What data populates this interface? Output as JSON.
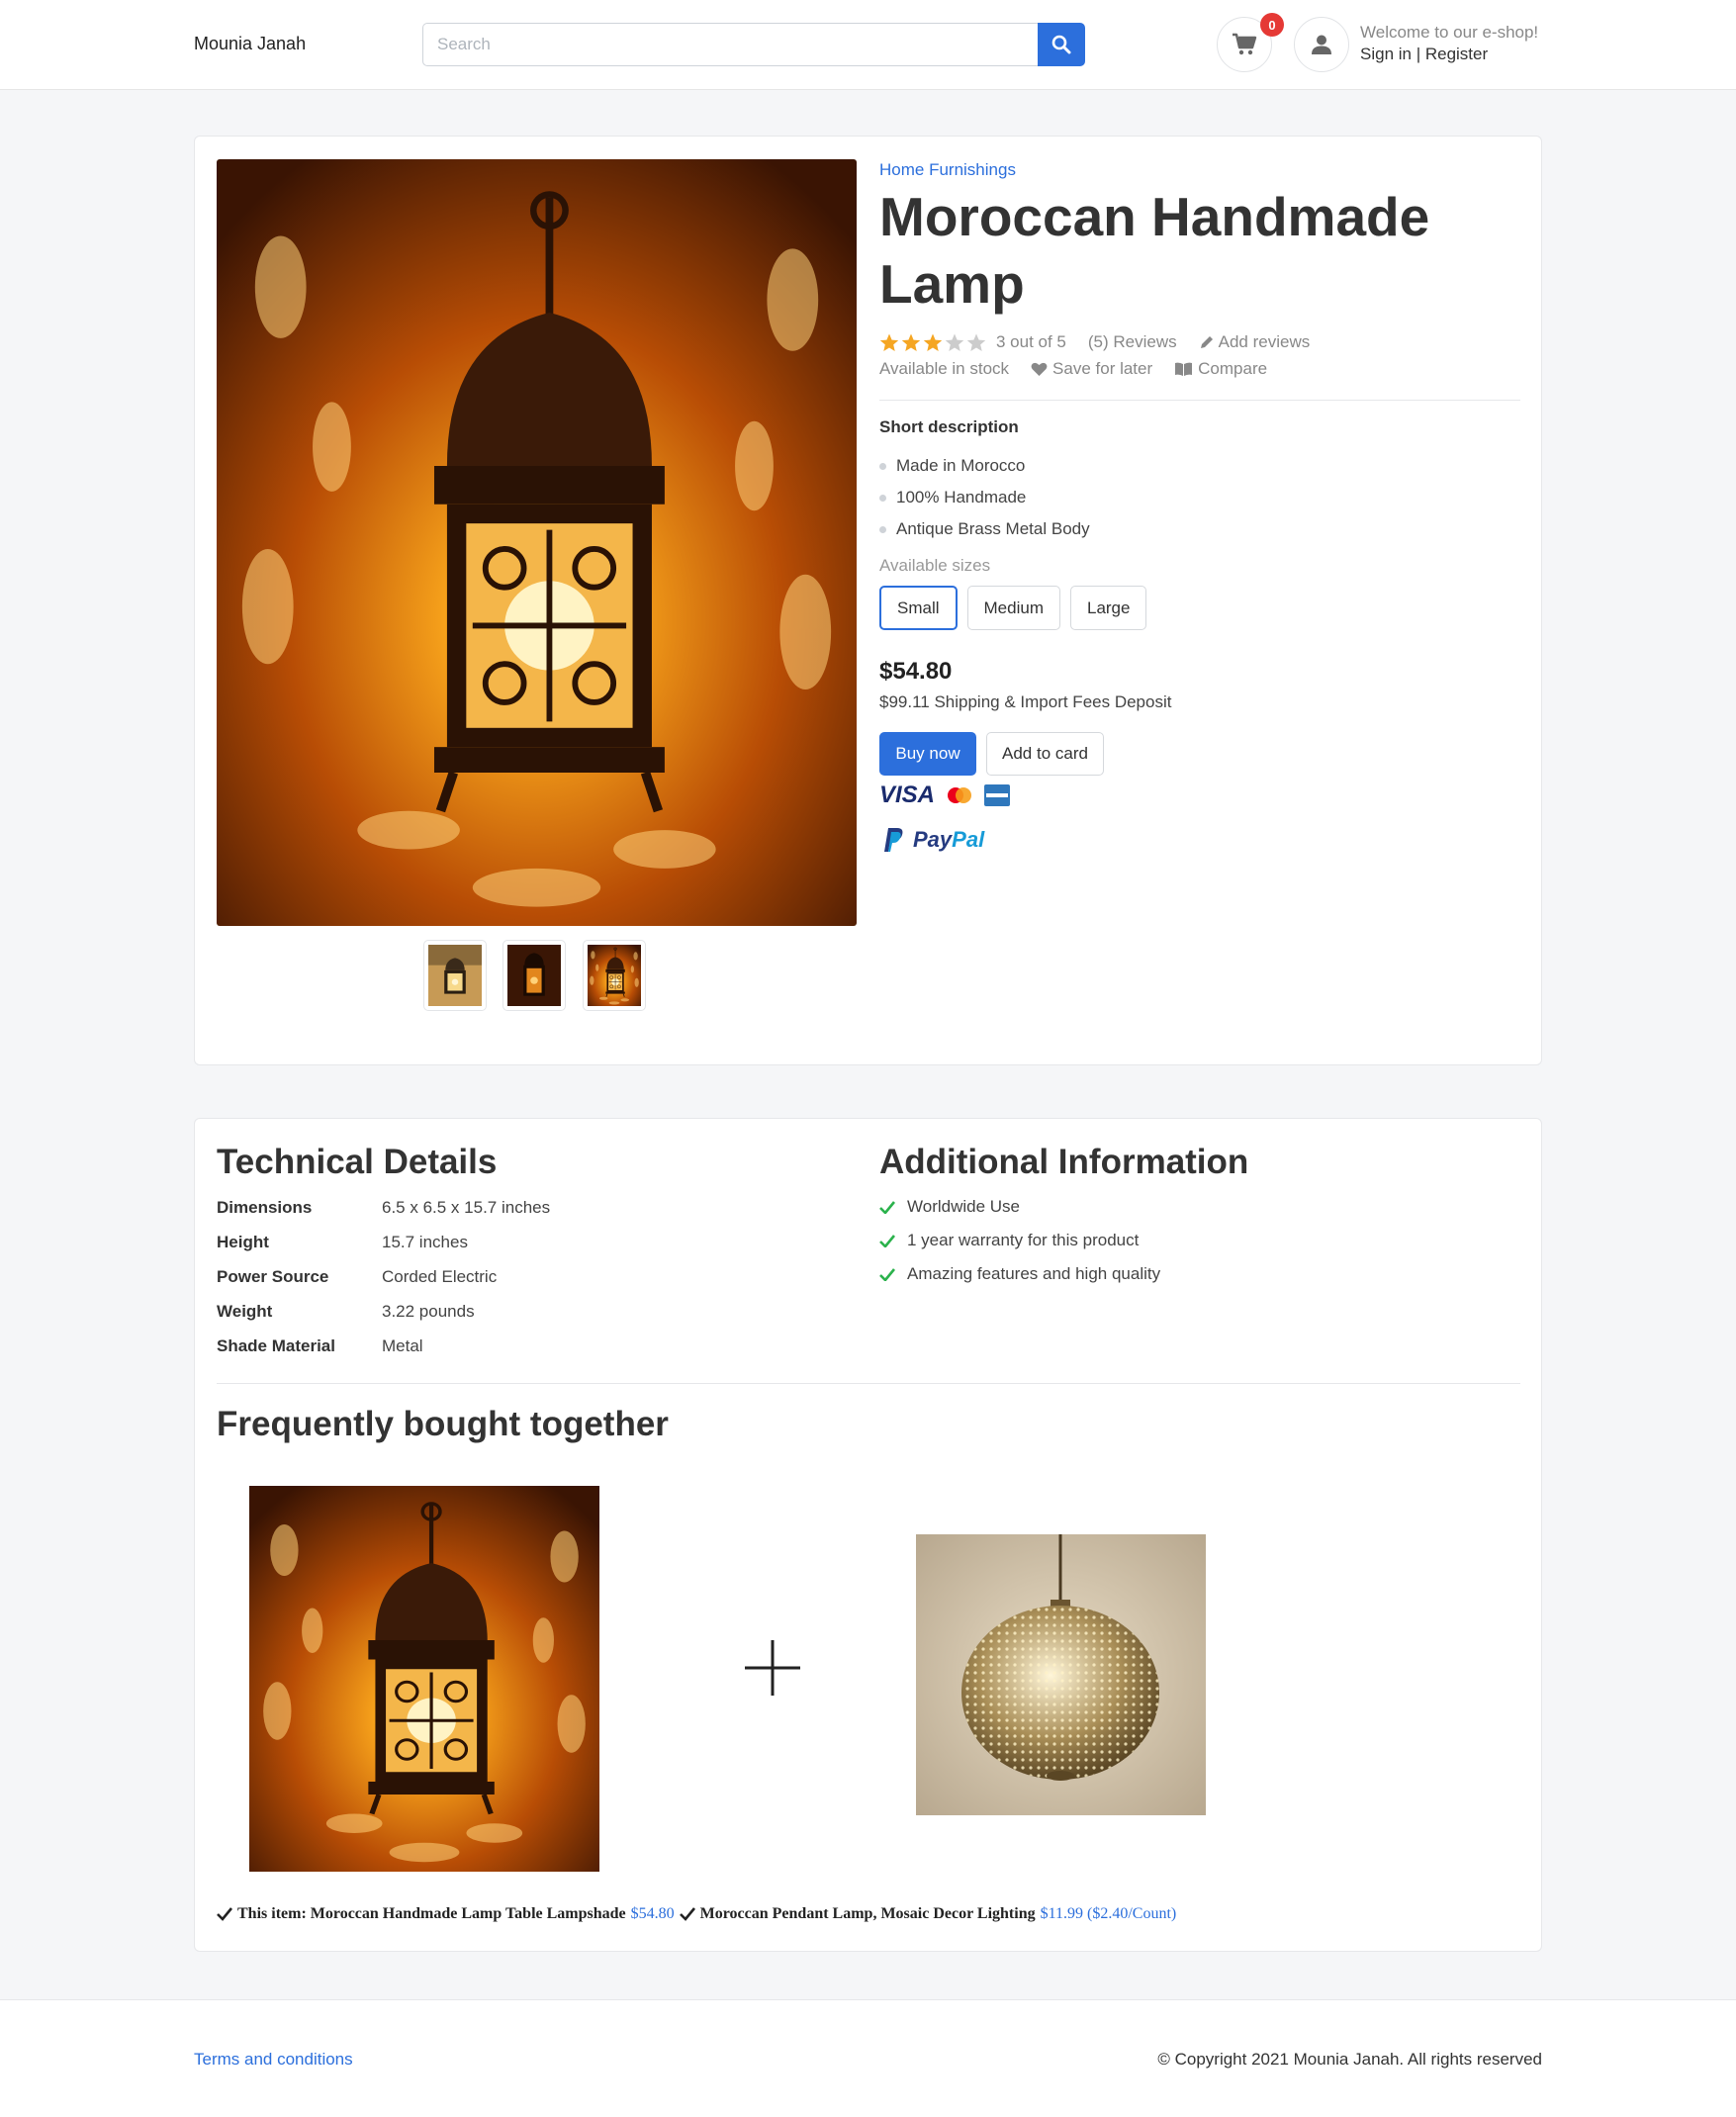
{
  "header": {
    "brand": "Mounia Janah",
    "search_placeholder": "Search",
    "cart_count": "0",
    "welcome": "Welcome to our e-shop!",
    "signin": "Sign in | Register"
  },
  "product": {
    "category": "Home Furnishings",
    "title": "Moroccan Handmade Lamp",
    "rating": 3,
    "rating_max": 5,
    "rating_text": "3 out of 5",
    "reviews": "(5) Reviews",
    "add_reviews": "Add reviews",
    "stock": "Available in stock",
    "save": "Save for later",
    "compare": "Compare",
    "short_title": "Short description",
    "bullets": [
      "Made in Morocco",
      "100% Handmade",
      "Antique Brass Metal Body"
    ],
    "sizes_label": "Available sizes",
    "sizes": [
      "Small",
      "Medium",
      "Large"
    ],
    "selected_size": "Small",
    "price": "$54.80",
    "shipping": "$99.11 Shipping & Import Fees Deposit",
    "buy_label": "Buy now",
    "add_label": "Add to card",
    "payments": {
      "visa": "VISA",
      "paypal_a": "Pay",
      "paypal_b": "Pal"
    }
  },
  "details": {
    "tech_title": "Technical Details",
    "tech": [
      {
        "k": "Dimensions",
        "v": "6.5 x 6.5 x 15.7 inches"
      },
      {
        "k": "Height",
        "v": "15.7 inches"
      },
      {
        "k": "Power Source",
        "v": "Corded Electric"
      },
      {
        "k": "Weight",
        "v": "3.22 pounds"
      },
      {
        "k": "Shade Material",
        "v": "Metal"
      }
    ],
    "info_title": "Additional Information",
    "info": [
      "Worldwide Use",
      "1 year warranty for this product",
      "Amazing features and high quality"
    ]
  },
  "fbt": {
    "title": "Frequently bought together",
    "item1_name": "This item: Moroccan Handmade Lamp Table Lampshade",
    "item1_price": "$54.80",
    "item2_name": "Moroccan Pendant Lamp, Mosaic Decor Lighting",
    "item2_price": "$11.99 ($2.40/Count)"
  },
  "footer": {
    "terms": "Terms and conditions",
    "copyright": "© Copyright 2021 Mounia Janah. All rights reserved"
  },
  "colors": {
    "accent": "#2c6fdc",
    "star": "#f5a623",
    "check": "#2bb24c",
    "badge": "#e53935"
  }
}
